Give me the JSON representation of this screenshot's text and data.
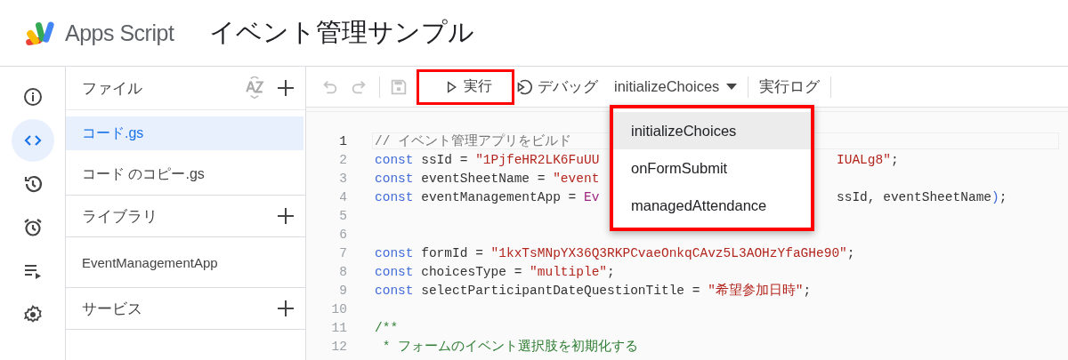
{
  "header": {
    "product": "Apps Script",
    "project_title": "イベント管理サンプル"
  },
  "rail": [
    {
      "selected": false
    },
    {
      "selected": true
    },
    {
      "selected": false
    },
    {
      "selected": false
    },
    {
      "selected": false
    },
    {
      "selected": false
    }
  ],
  "files_panel": {
    "title": "ファイル",
    "files": [
      {
        "name": "コード.gs",
        "selected": true
      },
      {
        "name": "コード のコピー.gs",
        "selected": false
      }
    ],
    "sections": [
      {
        "title": "ライブラリ",
        "items": [
          "EventManagementApp"
        ]
      },
      {
        "title": "サービス"
      }
    ]
  },
  "toolbar": {
    "undo_disabled": true,
    "redo_disabled": true,
    "save_disabled": true,
    "run": {
      "label": "実行",
      "highlighted": true
    },
    "debug": {
      "label": "デバッグ"
    },
    "function_selector": {
      "value": "initializeChoices"
    },
    "log": {
      "label": "実行ログ"
    }
  },
  "function_menu": {
    "highlighted": true,
    "items": [
      {
        "label": "initializeChoices",
        "selected": true
      },
      {
        "label": "onFormSubmit",
        "selected": false
      },
      {
        "label": "managedAttendance",
        "selected": false
      }
    ]
  },
  "code_lines": [
    {
      "number": "1",
      "current": true,
      "segments": [
        {
          "kind": "comment",
          "text": "// イベント管理アプリをビルド"
        }
      ]
    },
    {
      "number": "2",
      "current": false,
      "segments": [
        {
          "kind": "keyword",
          "text": "const"
        },
        {
          "kind": "plain",
          "text": " ssId = "
        },
        {
          "kind": "string",
          "text": "\"1PjfeHR2LK6FuUU"
        }
      ],
      "tail": [
        {
          "kind": "string",
          "text": "IUALg8\""
        },
        {
          "kind": "plain",
          "text": ";"
        }
      ]
    },
    {
      "number": "3",
      "current": false,
      "segments": [
        {
          "kind": "keyword",
          "text": "const"
        },
        {
          "kind": "plain",
          "text": " eventSheetName = "
        },
        {
          "kind": "string",
          "text": "\"event"
        }
      ]
    },
    {
      "number": "4",
      "current": false,
      "segments": [
        {
          "kind": "keyword",
          "text": "const"
        },
        {
          "kind": "plain",
          "text": " eventManagementApp = "
        },
        {
          "kind": "class",
          "text": "Ev"
        }
      ],
      "tail": [
        {
          "kind": "plain",
          "text": "ssId, eventSheetName"
        },
        {
          "kind": "punct",
          "text": ")"
        },
        {
          "kind": "plain",
          "text": ";"
        }
      ]
    },
    {
      "number": "5",
      "current": false
    },
    {
      "number": "6",
      "current": false
    },
    {
      "number": "7",
      "current": false,
      "segments": [
        {
          "kind": "keyword",
          "text": "const"
        },
        {
          "kind": "plain",
          "text": " formId = "
        },
        {
          "kind": "string",
          "text": "\"1kxTsMNpYX36Q3RKPCvaeOnkqCAvz5L3AOHzYfaGHe90\""
        },
        {
          "kind": "plain",
          "text": ";"
        }
      ]
    },
    {
      "number": "8",
      "current": false,
      "segments": [
        {
          "kind": "keyword",
          "text": "const"
        },
        {
          "kind": "plain",
          "text": " choicesType = "
        },
        {
          "kind": "string",
          "text": "\"multiple\""
        },
        {
          "kind": "plain",
          "text": ";"
        }
      ]
    },
    {
      "number": "9",
      "current": false,
      "segments": [
        {
          "kind": "keyword",
          "text": "const"
        },
        {
          "kind": "plain",
          "text": " selectParticipantDateQuestionTitle = "
        },
        {
          "kind": "string",
          "text": "\"希望参加日時\""
        },
        {
          "kind": "plain",
          "text": ";"
        }
      ]
    },
    {
      "number": "10",
      "current": false
    },
    {
      "number": "11",
      "current": false,
      "segments": [
        {
          "kind": "doc",
          "text": "/**"
        }
      ]
    },
    {
      "number": "12",
      "current": false,
      "segments": [
        {
          "kind": "doc",
          "text": " * フォームのイベント選択肢を初期化する"
        }
      ]
    }
  ]
}
